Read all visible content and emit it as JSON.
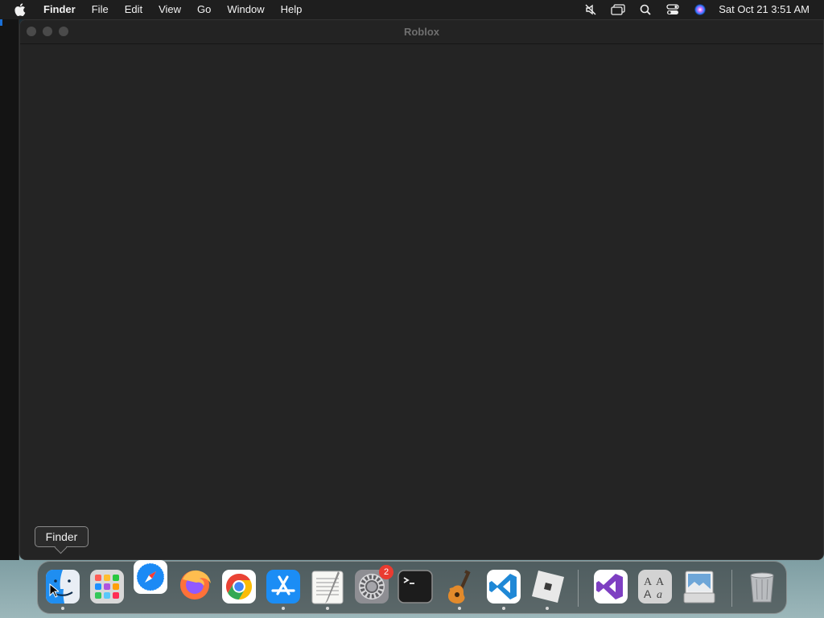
{
  "menubar": {
    "app_name": "Finder",
    "items": [
      "File",
      "Edit",
      "View",
      "Go",
      "Window",
      "Help"
    ],
    "clock": "Sat Oct 21  3:51 AM",
    "status_icons": [
      "mute-icon",
      "screen-mirroring-icon",
      "spotlight-search-icon",
      "control-center-icon",
      "siri-icon"
    ]
  },
  "window": {
    "title": "Roblox"
  },
  "tooltip": {
    "label": "Finder"
  },
  "dock": {
    "apps": [
      {
        "name": "Finder",
        "icon": "finder-icon",
        "running": true
      },
      {
        "name": "Launchpad",
        "icon": "launchpad-icon",
        "running": false
      },
      {
        "name": "Safari",
        "icon": "safari-icon",
        "running": false
      },
      {
        "name": "Firefox",
        "icon": "firefox-icon",
        "running": false
      },
      {
        "name": "Google Chrome",
        "icon": "chrome-icon",
        "running": false
      },
      {
        "name": "App Store",
        "icon": "app-store-icon",
        "running": true
      },
      {
        "name": "TextEdit",
        "icon": "textedit-icon",
        "running": true
      },
      {
        "name": "System Preferences",
        "icon": "system-preferences-icon",
        "running": false,
        "badge": "2"
      },
      {
        "name": "Terminal",
        "icon": "terminal-icon",
        "running": false
      },
      {
        "name": "GarageBand",
        "icon": "garageband-icon",
        "running": true
      },
      {
        "name": "Visual Studio Code",
        "icon": "vscode-icon",
        "running": true
      },
      {
        "name": "Roblox",
        "icon": "roblox-icon",
        "running": true
      },
      {
        "name": "Visual Studio",
        "icon": "visual-studio-icon",
        "running": false
      },
      {
        "name": "Font Book",
        "icon": "font-book-icon",
        "running": false
      },
      {
        "name": "Preview",
        "icon": "preview-icon",
        "running": false
      },
      {
        "name": "Trash",
        "icon": "trash-icon",
        "running": false
      }
    ]
  },
  "colors": {
    "menubar_bg": "#1e1e1e",
    "window_bg": "#242424",
    "badge_red": "#ea3b30"
  }
}
